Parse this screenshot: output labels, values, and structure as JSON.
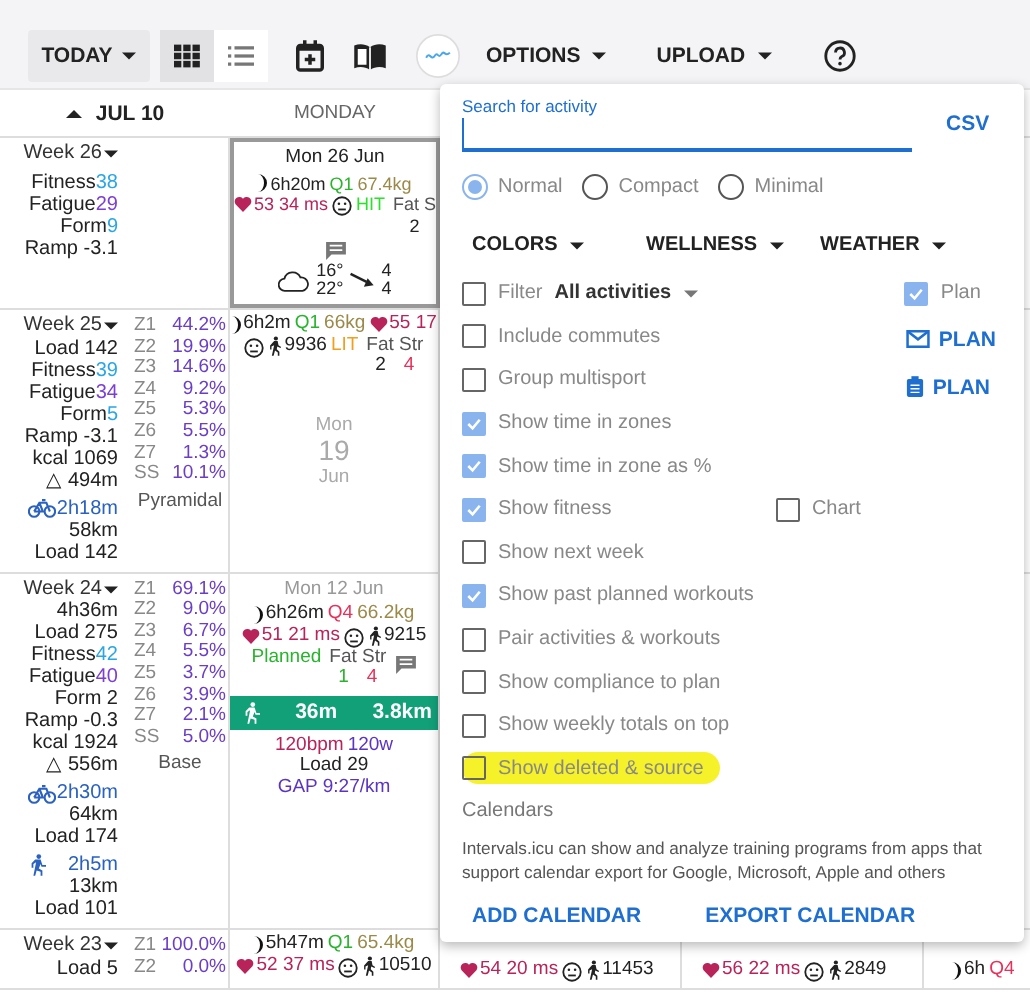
{
  "toolbar": {
    "today": "TODAY",
    "view_modes": [
      {
        "kind": "grid",
        "selected": true
      },
      {
        "kind": "list",
        "selected": false
      }
    ],
    "options": "OPTIONS",
    "upload": "UPLOAD"
  },
  "header": {
    "nav": "JUL 10",
    "day": "MONDAY"
  },
  "weeks": [
    {
      "label": "Week 26",
      "stats": [
        {
          "label": "Fitness",
          "value": "38",
          "color": "#2aa6e6"
        },
        {
          "label": "Fatigue",
          "value": "29",
          "color": "#7b3fd4"
        },
        {
          "label": "Form",
          "value": "9",
          "color": "#2aa6e6"
        },
        {
          "label": "Ramp -3.1"
        }
      ],
      "days": [
        {
          "selected": true,
          "blocks": [
            {
              "kind": "date",
              "text": "Mon 26 Jun",
              "color": "#222222"
            },
            {
              "kind": "line",
              "tokens": [
                {
                  "kind": "sleep",
                  "text": "6h20m"
                },
                {
                  "kind": "text",
                  "text": "Q1",
                  "color": "#28b42c"
                },
                {
                  "kind": "text",
                  "text": "67.4kg",
                  "color": "#9a8a4a"
                }
              ]
            },
            {
              "kind": "line",
              "tokens": [
                {
                  "kind": "hrv",
                  "text": "53 34 ms"
                },
                {
                  "kind": "mood"
                },
                {
                  "kind": "text",
                  "text": "HIT",
                  "color": "#2ee02e"
                },
                {
                  "kind": "fatstr",
                  "label": "Fat S",
                  "values": [
                    {
                      "text": "2",
                      "color": "#222222"
                    }
                  ]
                }
              ]
            },
            {
              "kind": "comment"
            },
            {
              "kind": "weather",
              "low": "16°",
              "high": "22°",
              "wind": [
                "4",
                "4"
              ]
            }
          ]
        }
      ]
    },
    {
      "label": "Week 25",
      "stats": [
        {
          "label": "Load 142"
        },
        {
          "label": "Fitness",
          "value": "39",
          "color": "#2aa6e6"
        },
        {
          "label": "Fatigue",
          "value": "34",
          "color": "#7b3fd4"
        },
        {
          "label": "Form",
          "value": "5",
          "color": "#2aa6e6"
        },
        {
          "label": "Ramp -3.1"
        },
        {
          "label": "kcal 1069"
        },
        {
          "label": "△ 494m"
        }
      ],
      "zones": [
        {
          "name": "Z1",
          "pct": "44.2%"
        },
        {
          "name": "Z2",
          "pct": "19.9%"
        },
        {
          "name": "Z3",
          "pct": "14.6%"
        },
        {
          "name": "Z4",
          "pct": "9.2%"
        },
        {
          "name": "Z5",
          "pct": "5.3%"
        },
        {
          "name": "Z6",
          "pct": "5.5%"
        },
        {
          "name": "Z7",
          "pct": "1.3%"
        },
        {
          "name": "SS",
          "pct": "10.1%"
        }
      ],
      "zone_type": "Pyramidal",
      "sports": [
        {
          "kind": "ride",
          "time": "2h18m",
          "distance": "58km",
          "load": "Load 142"
        }
      ],
      "days": [
        {
          "selected": false,
          "blocks": [
            {
              "kind": "line",
              "tokens": [
                {
                  "kind": "sleep",
                  "text": "6h2m"
                },
                {
                  "kind": "text",
                  "text": "Q1",
                  "color": "#28b42c"
                },
                {
                  "kind": "text",
                  "text": "66kg",
                  "color": "#9a8a4a"
                },
                {
                  "kind": "hrv",
                  "text": "55 17"
                }
              ]
            },
            {
              "kind": "line",
              "tokens": [
                {
                  "kind": "mood"
                },
                {
                  "kind": "steps",
                  "text": "9936"
                },
                {
                  "kind": "text",
                  "text": "LIT",
                  "color": "#f0a020"
                },
                {
                  "kind": "fatstr",
                  "label": "Fat Str",
                  "values": [
                    {
                      "text": "2",
                      "color": "#222222"
                    },
                    {
                      "text": "4",
                      "color": "#e8305a"
                    }
                  ]
                }
              ]
            },
            {
              "kind": "bigdate",
              "parts": [
                "Mon",
                "19",
                "Jun"
              ]
            }
          ]
        }
      ]
    },
    {
      "label": "Week 24",
      "stats": [
        {
          "label": "4h36m"
        },
        {
          "label": "Load 275"
        },
        {
          "label": "Fitness",
          "value": "42",
          "color": "#2aa6e6"
        },
        {
          "label": "Fatigue",
          "value": "40",
          "color": "#7b3fd4"
        },
        {
          "label": "Form 2"
        },
        {
          "label": "Ramp -0.3"
        },
        {
          "label": "kcal 1924"
        },
        {
          "label": "△ 556m"
        }
      ],
      "zones": [
        {
          "name": "Z1",
          "pct": "69.1%"
        },
        {
          "name": "Z2",
          "pct": "9.0%"
        },
        {
          "name": "Z3",
          "pct": "6.7%"
        },
        {
          "name": "Z4",
          "pct": "5.5%"
        },
        {
          "name": "Z5",
          "pct": "3.7%"
        },
        {
          "name": "Z6",
          "pct": "3.9%"
        },
        {
          "name": "Z7",
          "pct": "2.1%"
        },
        {
          "name": "SS",
          "pct": "5.0%"
        }
      ],
      "zone_type": "Base",
      "sports": [
        {
          "kind": "ride",
          "time": "2h30m",
          "distance": "64km",
          "load": "Load 174"
        },
        {
          "kind": "run",
          "time": "2h5m",
          "distance": "13km",
          "load": "Load 101"
        }
      ],
      "days": [
        {
          "selected": false,
          "blocks": [
            {
              "kind": "date",
              "text": "Mon 12 Jun",
              "color": "#999999"
            },
            {
              "kind": "line",
              "tokens": [
                {
                  "kind": "sleep",
                  "text": "6h26m"
                },
                {
                  "kind": "text",
                  "text": "Q4",
                  "color": "#e8305a"
                },
                {
                  "kind": "text",
                  "text": "66.2kg",
                  "color": "#9a8a4a"
                }
              ]
            },
            {
              "kind": "line",
              "tokens": [
                {
                  "kind": "hrv",
                  "text": "51 21 ms"
                },
                {
                  "kind": "mood"
                },
                {
                  "kind": "steps",
                  "text": "9215"
                }
              ]
            },
            {
              "kind": "line",
              "tokens": [
                {
                  "kind": "text",
                  "text": "Planned",
                  "color": "#28b42c"
                },
                {
                  "kind": "fatstr",
                  "label": "Fat Str",
                  "values": [
                    {
                      "text": "1",
                      "color": "#28b42c"
                    },
                    {
                      "text": "4",
                      "color": "#e8305a"
                    }
                  ]
                },
                {
                  "kind": "comment"
                }
              ]
            },
            {
              "kind": "activity",
              "activity": {
                "kind": "run",
                "time": "36m",
                "distance": "3.8km"
              }
            },
            {
              "kind": "line",
              "tokens": [
                {
                  "kind": "text",
                  "text": "120bpm",
                  "color": "#b8245a"
                },
                {
                  "kind": "text",
                  "text": "120w",
                  "color": "#5a35c0"
                }
              ]
            },
            {
              "kind": "line",
              "tokens": [
                {
                  "kind": "text",
                  "text": "Load 29",
                  "color": "#222222"
                }
              ]
            },
            {
              "kind": "line",
              "tokens": [
                {
                  "kind": "text",
                  "text": "GAP 9:27/km",
                  "color": "#5a35c0"
                }
              ]
            }
          ]
        }
      ]
    },
    {
      "label": "Week 23",
      "stats": [
        {
          "label": "Load 5"
        }
      ],
      "zones": [
        {
          "name": "Z1",
          "pct": "100.0%"
        },
        {
          "name": "Z2",
          "pct": "0.0%"
        }
      ],
      "days": [
        {
          "selected": false,
          "blocks": [
            {
              "kind": "line",
              "tokens": [
                {
                  "kind": "sleep",
                  "text": "5h47m"
                },
                {
                  "kind": "text",
                  "text": "Q1",
                  "color": "#28b42c"
                },
                {
                  "kind": "text",
                  "text": "65.4kg",
                  "color": "#9a8a4a"
                }
              ]
            },
            {
              "kind": "line",
              "tokens": [
                {
                  "kind": "hrv",
                  "text": "52 37 ms"
                },
                {
                  "kind": "mood"
                },
                {
                  "kind": "steps",
                  "text": "10510"
                }
              ]
            }
          ]
        },
        {
          "selected": false,
          "blocks": [
            {
              "kind": "line",
              "tokens": [
                {
                  "kind": "hrv",
                  "text": "54 20 ms"
                },
                {
                  "kind": "mood"
                },
                {
                  "kind": "steps",
                  "text": "11453"
                }
              ]
            }
          ]
        },
        {
          "selected": false,
          "blocks": [
            {
              "kind": "line",
              "tokens": [
                {
                  "kind": "hrv",
                  "text": "56 22 ms"
                },
                {
                  "kind": "mood"
                },
                {
                  "kind": "steps",
                  "text": "2849"
                }
              ]
            }
          ]
        },
        {
          "selected": false,
          "blocks": [
            {
              "kind": "line",
              "tokens": [
                {
                  "kind": "sleep",
                  "text": "6h"
                },
                {
                  "kind": "text",
                  "text": "Q4",
                  "color": "#e8305a"
                }
              ]
            }
          ]
        }
      ]
    }
  ],
  "popup": {
    "search": {
      "label": "Search for activity"
    },
    "csv": "CSV",
    "layouts": [
      {
        "label": "Normal",
        "selected": true
      },
      {
        "label": "Compact",
        "selected": false
      },
      {
        "label": "Minimal",
        "selected": false
      }
    ],
    "menus": [
      "COLORS",
      "WELLNESS",
      "WEATHER"
    ],
    "filter": {
      "label": "Filter",
      "checked": false,
      "value": "All activities"
    },
    "options": [
      {
        "label": "Include commutes",
        "checked": false
      },
      {
        "label": "Group multisport",
        "checked": false
      },
      {
        "label": "Show time in zones",
        "checked": true
      },
      {
        "label": "Show time in zone as %",
        "checked": true
      },
      {
        "label": "Show fitness",
        "checked": true,
        "extra": {
          "label": "Chart",
          "checked": false
        }
      },
      {
        "label": "Show next week",
        "checked": false
      },
      {
        "label": "Show past planned workouts",
        "checked": true
      },
      {
        "label": "Pair activities & workouts",
        "checked": false
      },
      {
        "label": "Show compliance to plan",
        "checked": false
      },
      {
        "label": "Show weekly totals on top",
        "checked": false
      },
      {
        "label": "Show deleted & source",
        "checked": false,
        "highlighted": true
      }
    ],
    "plan": {
      "label": "Plan",
      "checked": true
    },
    "plan_buttons": [
      {
        "kind": "email",
        "label": "PLAN"
      },
      {
        "kind": "clipboard",
        "label": "PLAN"
      }
    ],
    "calendars_title": "Calendars",
    "calendars_text": "Intervals.icu can show and analyze training programs from apps that support calendar export for Google, Microsoft, Apple and others",
    "calendar_buttons": [
      "ADD CALENDAR",
      "EXPORT CALENDAR"
    ]
  }
}
